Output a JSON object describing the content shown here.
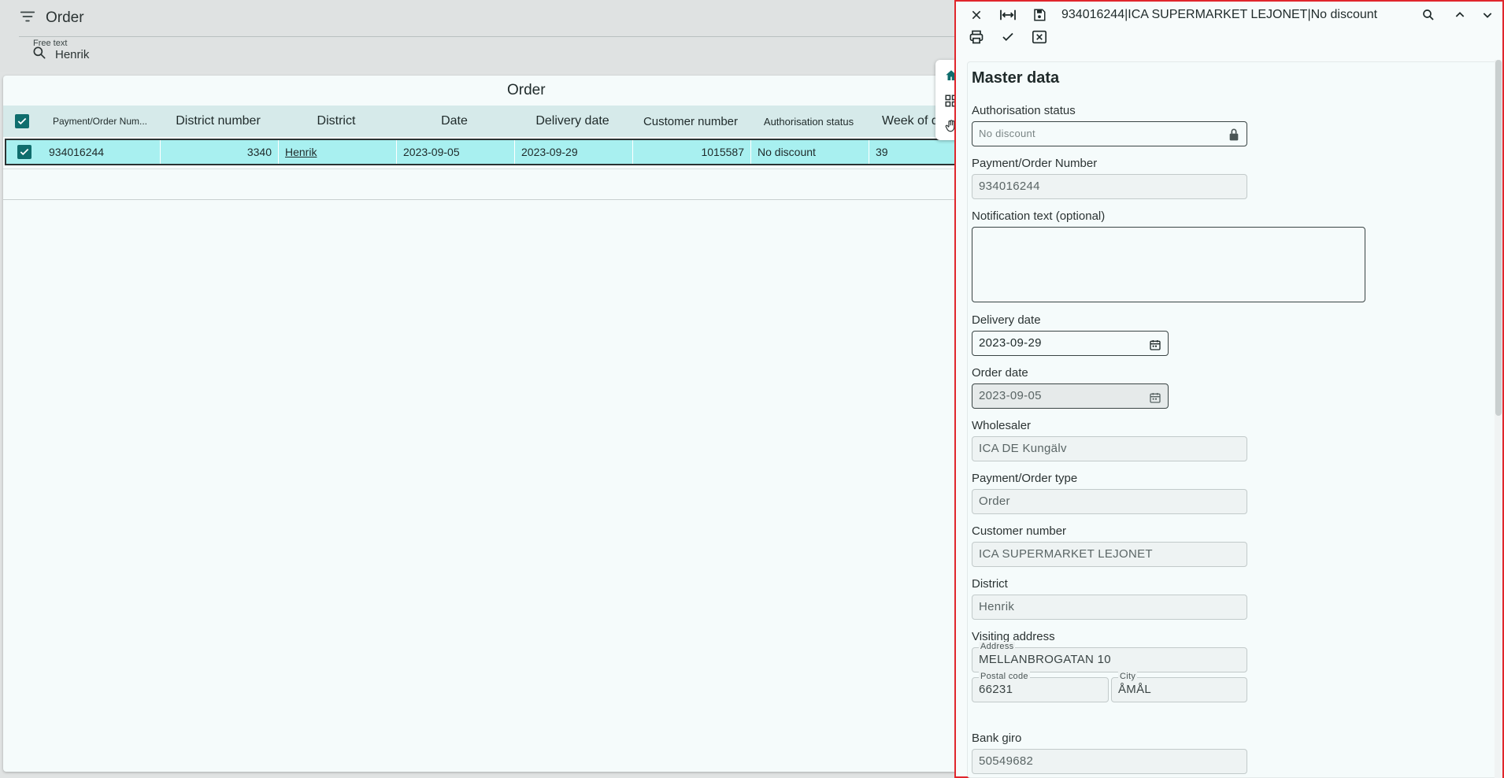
{
  "filter": {
    "title": "Order",
    "free_text_label": "Free text",
    "free_text_value": "Henrik"
  },
  "order_panel": {
    "title": "Order",
    "columns": [
      "Payment/Order Num...",
      "District number",
      "District",
      "Date",
      "Delivery date",
      "Customer number",
      "Authorisation status",
      "Week of d"
    ],
    "rows": [
      [
        "934016244",
        "3340",
        "Henrik",
        "2023-09-05",
        "2023-09-29",
        "1015587",
        "No discount",
        "39"
      ]
    ]
  },
  "detail": {
    "title": "934016244|ICA SUPERMARKET LEJONET|No discount",
    "section_title": "Master data",
    "authorisation_status": {
      "label": "Authorisation status",
      "value": "No discount"
    },
    "order_number": {
      "label": "Payment/Order Number",
      "value": "934016244"
    },
    "notification": {
      "label": "Notification text (optional)",
      "value": ""
    },
    "delivery_date": {
      "label": "Delivery date",
      "value": "2023-09-29"
    },
    "order_date": {
      "label": "Order date",
      "value": "2023-09-05"
    },
    "wholesaler": {
      "label": "Wholesaler",
      "value": "ICA DE Kungälv"
    },
    "order_type": {
      "label": "Payment/Order type",
      "value": "Order"
    },
    "customer_number": {
      "label": "Customer number",
      "value": "ICA SUPERMARKET LEJONET"
    },
    "district": {
      "label": "District",
      "value": "Henrik"
    },
    "visiting_address": {
      "label": "Visiting address",
      "address_label": "Address",
      "address_value": "MELLANBROGATAN 10",
      "postal_label": "Postal code",
      "postal_value": "66231",
      "city_label": "City",
      "city_value": "ÅMÅL"
    },
    "bank_giro": {
      "label": "Bank giro",
      "value": "50549682"
    }
  },
  "colors": {
    "accent": "#0f6d6d",
    "selected_row": "#a8f0f0",
    "highlight_border": "#e0262c"
  }
}
